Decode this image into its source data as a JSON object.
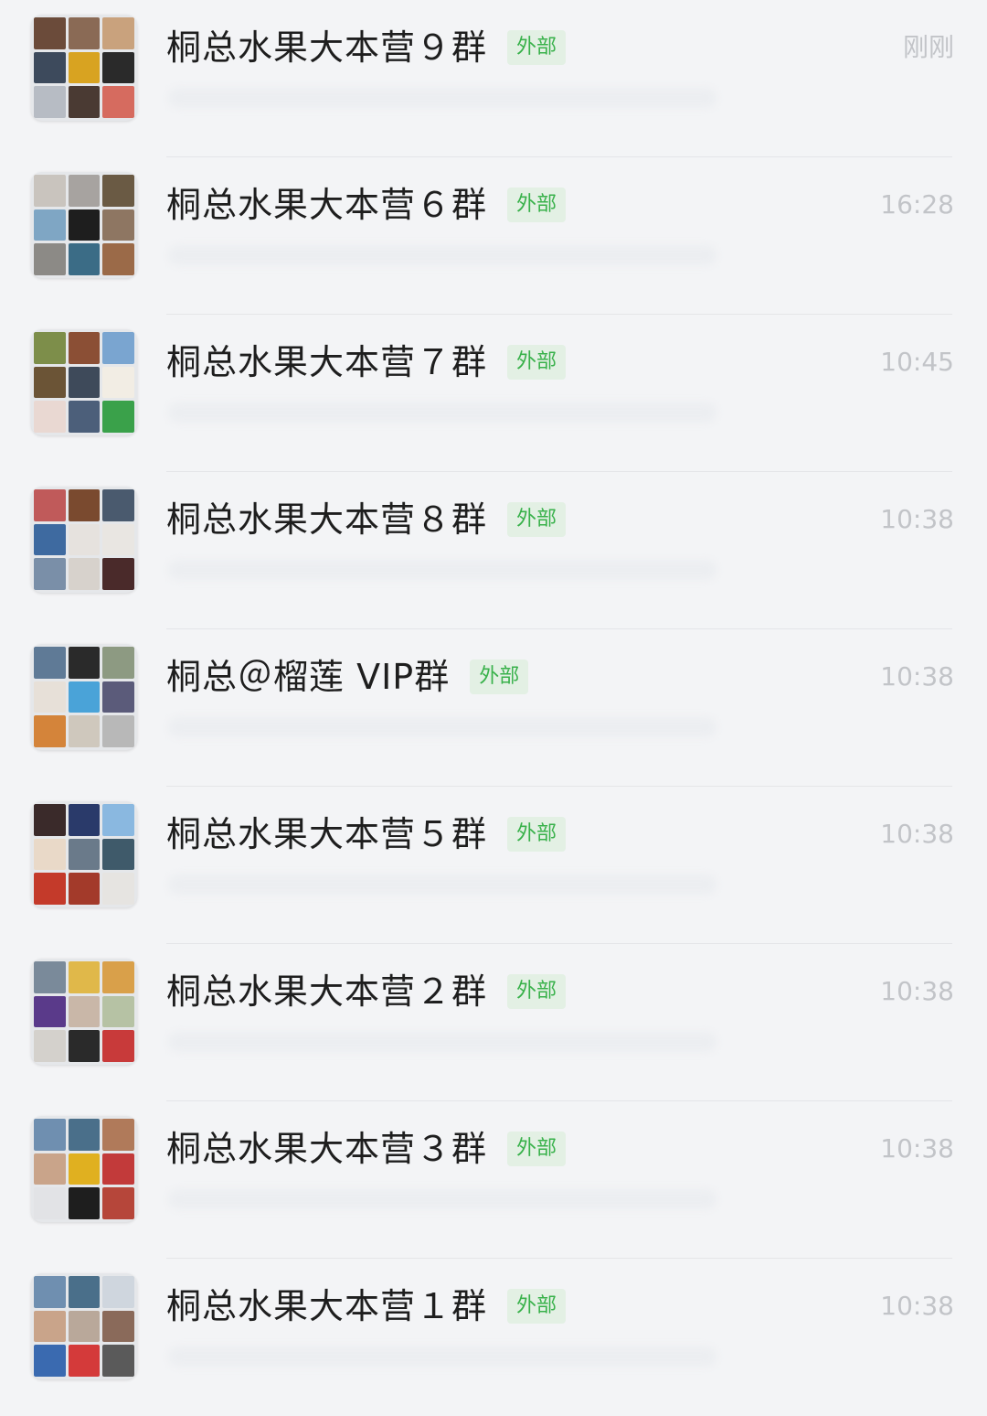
{
  "chats": [
    {
      "name": "桐总水果大本营９群",
      "tag": "外部",
      "time": "刚刚",
      "avatar": [
        "#6b4b3a",
        "#8a6a55",
        "#c9a27d",
        "#3d4a5c",
        "#d8a321",
        "#2a2a2a",
        "#b7bcc4",
        "#4a3a33",
        "#d66b5f"
      ]
    },
    {
      "name": "桐总水果大本营６群",
      "tag": "外部",
      "time": "16:28",
      "avatar": [
        "#c9c4be",
        "#a7a3a0",
        "#6a5a44",
        "#7fa6c4",
        "#1e1e1e",
        "#8e7662",
        "#8c8a86",
        "#3b6c86",
        "#9b6a48"
      ]
    },
    {
      "name": "桐总水果大本营７群",
      "tag": "外部",
      "time": "10:45",
      "avatar": [
        "#7d8e4a",
        "#8b4f35",
        "#7aa5d0",
        "#6b5436",
        "#3e4a5a",
        "#f2ede4",
        "#e9d8d2",
        "#4c5f7a",
        "#3aa14a"
      ]
    },
    {
      "name": "桐总水果大本营８群",
      "tag": "外部",
      "time": "10:38",
      "avatar": [
        "#c05a5a",
        "#7a4a2f",
        "#4a5a6e",
        "#3e6aa0",
        "#e6e2de",
        "#e9e6e2",
        "#7a8fa8",
        "#d7d2cc",
        "#4a2a2a"
      ]
    },
    {
      "name": "桐总＠榴莲 VIP群",
      "tag": "外部",
      "time": "10:38",
      "avatar": [
        "#5f7a96",
        "#2a2a2a",
        "#8d9a82",
        "#e7e0d8",
        "#4aa3d8",
        "#5b5b7a",
        "#d4843a",
        "#cfc8bd",
        "#b8b8b8"
      ]
    },
    {
      "name": "桐总水果大本营５群",
      "tag": "外部",
      "time": "10:38",
      "avatar": [
        "#3a2a2a",
        "#2a3a6a",
        "#8ab8e0",
        "#e9d9c8",
        "#6a7a8a",
        "#3f5a6a",
        "#c43a2a",
        "#a33a2a",
        "#e6e4e1"
      ]
    },
    {
      "name": "桐总水果大本营２群",
      "tag": "外部",
      "time": "10:38",
      "avatar": [
        "#7a8a9a",
        "#e0b84a",
        "#d9a04a",
        "#5a3a8a",
        "#c9b7a8",
        "#b6c2a4",
        "#d4d1cc",
        "#2a2a2a",
        "#c83a3a"
      ]
    },
    {
      "name": "桐总水果大本营３群",
      "tag": "外部",
      "time": "10:38",
      "avatar": [
        "#6f8fb0",
        "#4a6f8a",
        "#b07a5a",
        "#c9a48a",
        "#e0b020",
        "#c23a3a",
        "#e2e3e6",
        "#1e1e1e",
        "#b6463a"
      ]
    },
    {
      "name": "桐总水果大本营１群",
      "tag": "外部",
      "time": "10:38",
      "avatar": [
        "#6f8fb0",
        "#4a6f8a",
        "#cfd6de",
        "#c9a48a",
        "#b9a89a",
        "#8a6a5a",
        "#3a6ab0",
        "#d43a3a",
        "#5a5a5a"
      ]
    }
  ]
}
